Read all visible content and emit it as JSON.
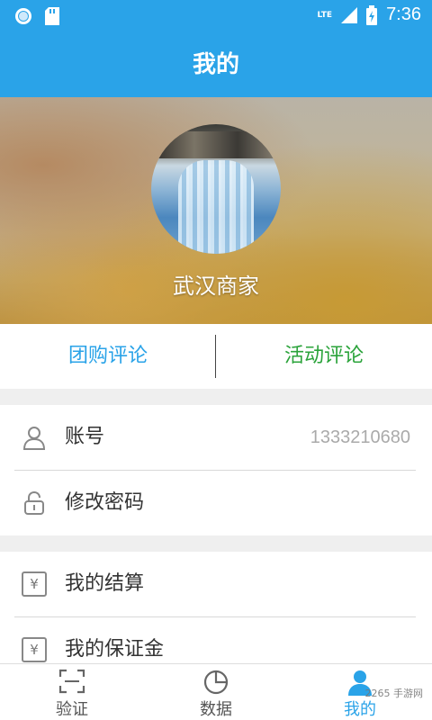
{
  "status_bar": {
    "time": "7:36",
    "network": "LTE"
  },
  "title": "我的",
  "profile": {
    "shop_name": "武汉商家"
  },
  "tabs": [
    {
      "label": "团购评论",
      "color": "#2aa3e8"
    },
    {
      "label": "活动评论",
      "color": "#2aa33a"
    }
  ],
  "account_group": {
    "account": {
      "label": "账号",
      "value": "1333210680"
    },
    "password": {
      "label": "修改密码"
    }
  },
  "finance_group": {
    "settlement": {
      "label": "我的结算",
      "icon_text": "¥"
    },
    "deposit": {
      "label": "我的保证金",
      "icon_text": "¥"
    }
  },
  "bottom_nav": [
    {
      "label": "验证",
      "icon": "scan-icon"
    },
    {
      "label": "数据",
      "icon": "pie-chart-icon"
    },
    {
      "label": "我的",
      "icon": "user-icon"
    }
  ],
  "watermark": "2265 手游网",
  "colors": {
    "primary": "#2aa3e8",
    "green": "#2aa33a"
  }
}
